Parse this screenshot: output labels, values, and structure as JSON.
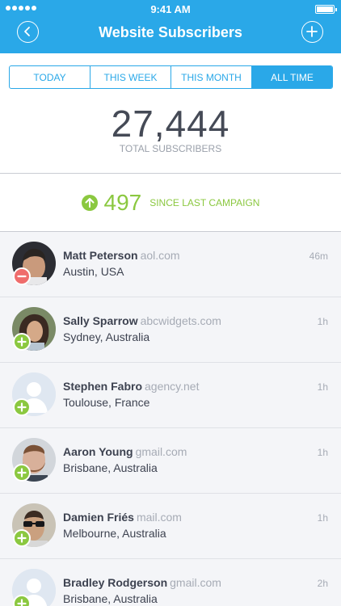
{
  "status_bar": {
    "time": "9:41 AM"
  },
  "header": {
    "title": "Website Subscribers"
  },
  "tabs": [
    {
      "label": "TODAY",
      "active": false
    },
    {
      "label": "THIS WEEK",
      "active": false
    },
    {
      "label": "THIS MONTH",
      "active": false
    },
    {
      "label": "ALL TIME",
      "active": true
    }
  ],
  "summary": {
    "total": "27,444",
    "total_label": "TOTAL SUBSCRIBERS"
  },
  "campaign": {
    "count": "497",
    "label": "SINCE LAST CAMPAIGN"
  },
  "subscribers": [
    {
      "name": "Matt Peterson",
      "domain": "aol.com",
      "location": "Austin, USA",
      "ago": "46m",
      "action": "remove",
      "avatar": "photo-dark"
    },
    {
      "name": "Sally Sparrow",
      "domain": "abcwidgets.com",
      "location": "Sydney, Australia",
      "ago": "1h",
      "action": "add",
      "avatar": "photo-woman"
    },
    {
      "name": "Stephen Fabro",
      "domain": "agency.net",
      "location": "Toulouse, France",
      "ago": "1h",
      "action": "add",
      "avatar": "placeholder"
    },
    {
      "name": "Aaron Young",
      "domain": "gmail.com",
      "location": "Brisbane, Australia",
      "ago": "1h",
      "action": "add",
      "avatar": "photo-beard"
    },
    {
      "name": "Damien Friés",
      "domain": "mail.com",
      "location": "Melbourne, Australia",
      "ago": "1h",
      "action": "add",
      "avatar": "photo-sunglasses"
    },
    {
      "name": "Bradley Rodgerson",
      "domain": "gmail.com",
      "location": "Brisbane, Australia",
      "ago": "2h",
      "action": "add",
      "avatar": "placeholder"
    }
  ],
  "colors": {
    "accent": "#2aa8e8",
    "positive": "#8bc840",
    "negative": "#ef6c6c"
  }
}
